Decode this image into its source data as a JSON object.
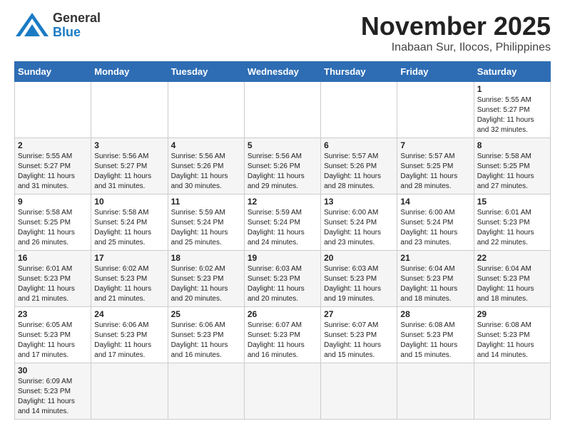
{
  "header": {
    "logo_general": "General",
    "logo_blue": "Blue",
    "month": "November 2025",
    "location": "Inabaan Sur, Ilocos, Philippines"
  },
  "weekdays": [
    "Sunday",
    "Monday",
    "Tuesday",
    "Wednesday",
    "Thursday",
    "Friday",
    "Saturday"
  ],
  "weeks": [
    [
      {
        "day": "",
        "info": ""
      },
      {
        "day": "",
        "info": ""
      },
      {
        "day": "",
        "info": ""
      },
      {
        "day": "",
        "info": ""
      },
      {
        "day": "",
        "info": ""
      },
      {
        "day": "",
        "info": ""
      },
      {
        "day": "1",
        "info": "Sunrise: 5:55 AM\nSunset: 5:27 PM\nDaylight: 11 hours\nand 32 minutes."
      }
    ],
    [
      {
        "day": "2",
        "info": "Sunrise: 5:55 AM\nSunset: 5:27 PM\nDaylight: 11 hours\nand 31 minutes."
      },
      {
        "day": "3",
        "info": "Sunrise: 5:56 AM\nSunset: 5:27 PM\nDaylight: 11 hours\nand 31 minutes."
      },
      {
        "day": "4",
        "info": "Sunrise: 5:56 AM\nSunset: 5:26 PM\nDaylight: 11 hours\nand 30 minutes."
      },
      {
        "day": "5",
        "info": "Sunrise: 5:56 AM\nSunset: 5:26 PM\nDaylight: 11 hours\nand 29 minutes."
      },
      {
        "day": "6",
        "info": "Sunrise: 5:57 AM\nSunset: 5:26 PM\nDaylight: 11 hours\nand 28 minutes."
      },
      {
        "day": "7",
        "info": "Sunrise: 5:57 AM\nSunset: 5:25 PM\nDaylight: 11 hours\nand 28 minutes."
      },
      {
        "day": "8",
        "info": "Sunrise: 5:58 AM\nSunset: 5:25 PM\nDaylight: 11 hours\nand 27 minutes."
      }
    ],
    [
      {
        "day": "9",
        "info": "Sunrise: 5:58 AM\nSunset: 5:25 PM\nDaylight: 11 hours\nand 26 minutes."
      },
      {
        "day": "10",
        "info": "Sunrise: 5:58 AM\nSunset: 5:24 PM\nDaylight: 11 hours\nand 25 minutes."
      },
      {
        "day": "11",
        "info": "Sunrise: 5:59 AM\nSunset: 5:24 PM\nDaylight: 11 hours\nand 25 minutes."
      },
      {
        "day": "12",
        "info": "Sunrise: 5:59 AM\nSunset: 5:24 PM\nDaylight: 11 hours\nand 24 minutes."
      },
      {
        "day": "13",
        "info": "Sunrise: 6:00 AM\nSunset: 5:24 PM\nDaylight: 11 hours\nand 23 minutes."
      },
      {
        "day": "14",
        "info": "Sunrise: 6:00 AM\nSunset: 5:24 PM\nDaylight: 11 hours\nand 23 minutes."
      },
      {
        "day": "15",
        "info": "Sunrise: 6:01 AM\nSunset: 5:23 PM\nDaylight: 11 hours\nand 22 minutes."
      }
    ],
    [
      {
        "day": "16",
        "info": "Sunrise: 6:01 AM\nSunset: 5:23 PM\nDaylight: 11 hours\nand 21 minutes."
      },
      {
        "day": "17",
        "info": "Sunrise: 6:02 AM\nSunset: 5:23 PM\nDaylight: 11 hours\nand 21 minutes."
      },
      {
        "day": "18",
        "info": "Sunrise: 6:02 AM\nSunset: 5:23 PM\nDaylight: 11 hours\nand 20 minutes."
      },
      {
        "day": "19",
        "info": "Sunrise: 6:03 AM\nSunset: 5:23 PM\nDaylight: 11 hours\nand 20 minutes."
      },
      {
        "day": "20",
        "info": "Sunrise: 6:03 AM\nSunset: 5:23 PM\nDaylight: 11 hours\nand 19 minutes."
      },
      {
        "day": "21",
        "info": "Sunrise: 6:04 AM\nSunset: 5:23 PM\nDaylight: 11 hours\nand 18 minutes."
      },
      {
        "day": "22",
        "info": "Sunrise: 6:04 AM\nSunset: 5:23 PM\nDaylight: 11 hours\nand 18 minutes."
      }
    ],
    [
      {
        "day": "23",
        "info": "Sunrise: 6:05 AM\nSunset: 5:23 PM\nDaylight: 11 hours\nand 17 minutes."
      },
      {
        "day": "24",
        "info": "Sunrise: 6:06 AM\nSunset: 5:23 PM\nDaylight: 11 hours\nand 17 minutes."
      },
      {
        "day": "25",
        "info": "Sunrise: 6:06 AM\nSunset: 5:23 PM\nDaylight: 11 hours\nand 16 minutes."
      },
      {
        "day": "26",
        "info": "Sunrise: 6:07 AM\nSunset: 5:23 PM\nDaylight: 11 hours\nand 16 minutes."
      },
      {
        "day": "27",
        "info": "Sunrise: 6:07 AM\nSunset: 5:23 PM\nDaylight: 11 hours\nand 15 minutes."
      },
      {
        "day": "28",
        "info": "Sunrise: 6:08 AM\nSunset: 5:23 PM\nDaylight: 11 hours\nand 15 minutes."
      },
      {
        "day": "29",
        "info": "Sunrise: 6:08 AM\nSunset: 5:23 PM\nDaylight: 11 hours\nand 14 minutes."
      }
    ],
    [
      {
        "day": "30",
        "info": "Sunrise: 6:09 AM\nSunset: 5:23 PM\nDaylight: 11 hours\nand 14 minutes."
      },
      {
        "day": "",
        "info": ""
      },
      {
        "day": "",
        "info": ""
      },
      {
        "day": "",
        "info": ""
      },
      {
        "day": "",
        "info": ""
      },
      {
        "day": "",
        "info": ""
      },
      {
        "day": "",
        "info": ""
      }
    ]
  ]
}
